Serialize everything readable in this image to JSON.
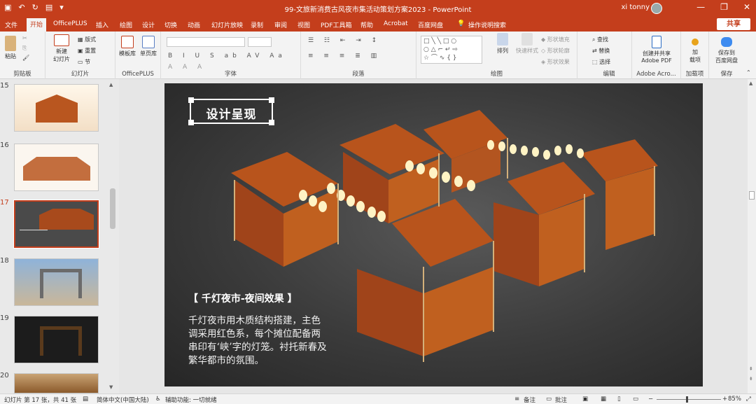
{
  "titlebar": {
    "document_title": "99-文旅新消费古风夜市集活动策划方案2023  -  PowerPoint",
    "user_name": "xi tonny"
  },
  "tabs": [
    {
      "id": "file",
      "label": "文件"
    },
    {
      "id": "home",
      "label": "开始"
    },
    {
      "id": "officeplus",
      "label": "OfficePLUS"
    },
    {
      "id": "insert",
      "label": "插入"
    },
    {
      "id": "draw",
      "label": "绘图"
    },
    {
      "id": "design",
      "label": "设计"
    },
    {
      "id": "transitions",
      "label": "切换"
    },
    {
      "id": "animations",
      "label": "动画"
    },
    {
      "id": "slideshow",
      "label": "幻灯片放映"
    },
    {
      "id": "record",
      "label": "录制"
    },
    {
      "id": "review",
      "label": "审阅"
    },
    {
      "id": "view",
      "label": "视图"
    },
    {
      "id": "pdf",
      "label": "PDF工具箱"
    },
    {
      "id": "help",
      "label": "帮助"
    },
    {
      "id": "acrobat",
      "label": "Acrobat"
    },
    {
      "id": "baidu",
      "label": "百度网盘"
    },
    {
      "id": "tellme",
      "label": "操作说明搜索"
    }
  ],
  "share_label": "共享",
  "ribbon": {
    "clipboard": {
      "paste": "粘贴",
      "group": "剪贴板"
    },
    "slides": {
      "new_slide": "新建",
      "new_slide2": "幻灯片",
      "layout": "版式",
      "reset": "重置",
      "section": "节",
      "group": "幻灯片"
    },
    "officeplus": {
      "template": "模板库",
      "single": "单页库",
      "group": "OfficePLUS"
    },
    "font": {
      "group": "字体"
    },
    "paragraph": {
      "group": "段落"
    },
    "drawing": {
      "arrange": "排列",
      "quick_styles": "快速样式",
      "fill": "形状填充",
      "outline": "形状轮廓",
      "effects": "形状效果",
      "group": "绘图"
    },
    "editing": {
      "find": "查找",
      "replace": "替换",
      "select": "选择",
      "group": "编辑"
    },
    "adobe": {
      "create1": "创建并共享",
      "create2": "Adobe PDF",
      "group": "Adobe Acro..."
    },
    "addins": {
      "add1": "加",
      "add2": "载项",
      "group": "加载项"
    },
    "save": {
      "save1": "保存到",
      "save2": "百度网盘",
      "group": "保存"
    }
  },
  "thumbnails": [
    {
      "num": "15",
      "selected": false
    },
    {
      "num": "16",
      "selected": false
    },
    {
      "num": "17",
      "selected": true
    },
    {
      "num": "18",
      "selected": false
    },
    {
      "num": "19",
      "selected": false
    },
    {
      "num": "20",
      "selected": false
    }
  ],
  "slide": {
    "title": "设计呈现",
    "subtitle": "【 千灯夜市-夜间效果 】",
    "body": "千灯夜市用木质结构搭建，主色调采用红色系，每个摊位配备两串印有‘峡’字的灯笼。衬托新春及繁华都市的氛围。"
  },
  "status": {
    "slide_info": "幻灯片 第 17 张，共 41 张",
    "language": "简体中文(中国大陆)",
    "accessibility": "辅助功能: 一切就绪",
    "notes": "备注",
    "comments": "批注",
    "zoom": "85%"
  },
  "colors": {
    "accent": "#c43e1c"
  }
}
